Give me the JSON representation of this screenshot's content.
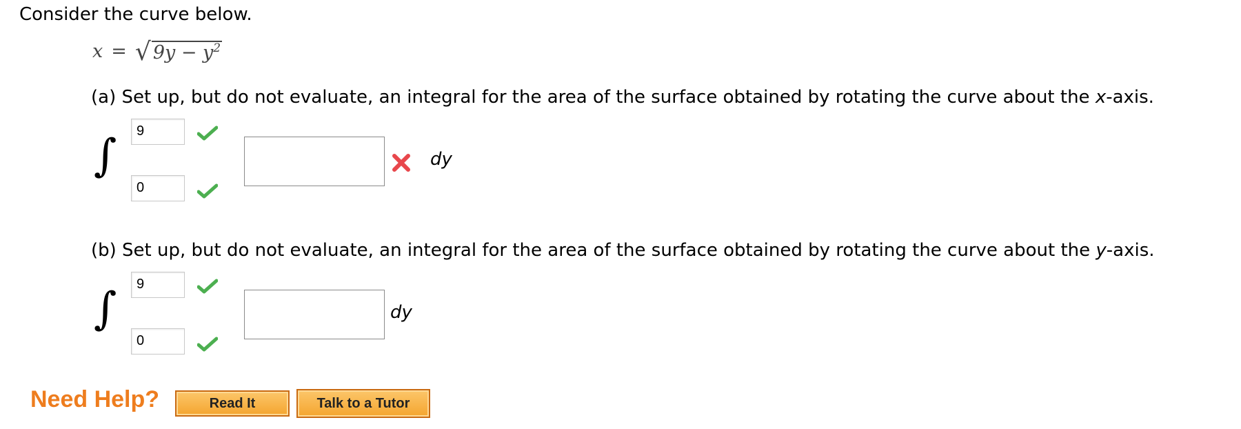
{
  "intro": "Consider the curve below.",
  "equation": {
    "lhs": "x",
    "op": "=",
    "radicand": "9y − y",
    "exponent": "2"
  },
  "part_a": {
    "question_pre": "(a) Set up, but do not evaluate, an integral for the area of the surface obtained by rotating the curve about the ",
    "axis": "x",
    "question_post": "-axis.",
    "integral_sign": "∫",
    "upper": "9",
    "lower": "0",
    "integrand": "",
    "differential": "dy",
    "upper_status": "correct",
    "lower_status": "correct",
    "integrand_status": "incorrect"
  },
  "part_b": {
    "question_pre": "(b) Set up, but do not evaluate, an integral for the area of the surface obtained by rotating the curve about the ",
    "axis": "y",
    "question_post": "-axis.",
    "integral_sign": "∫",
    "upper": "9",
    "lower": "0",
    "integrand": "",
    "differential": "dy",
    "upper_status": "correct",
    "lower_status": "correct"
  },
  "help": {
    "label": "Need Help?",
    "read_it": "Read It",
    "talk_to_tutor": "Talk to a Tutor"
  },
  "colors": {
    "check": "#4caf50",
    "cross": "#e8474c",
    "help_orange": "#ee7d1e",
    "button": "#f4a52f"
  },
  "icons": {
    "correct": "checkmark-icon",
    "incorrect": "x-icon"
  }
}
